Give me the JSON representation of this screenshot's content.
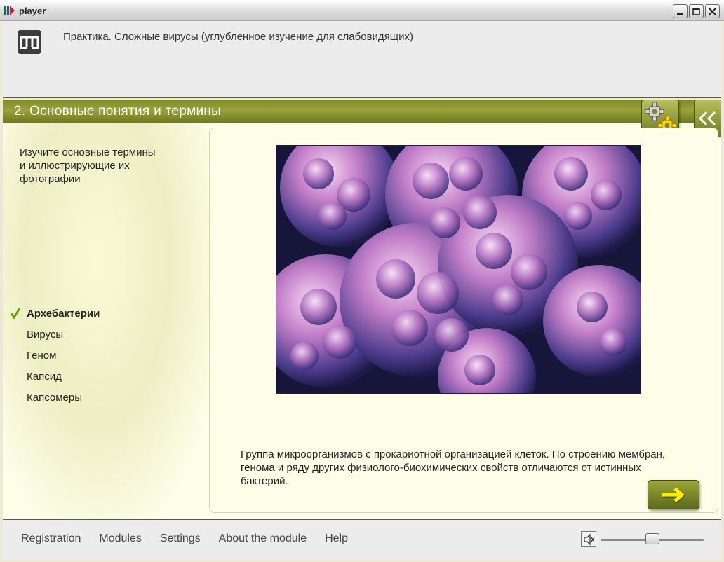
{
  "window": {
    "title": "player"
  },
  "header": {
    "module_title": "Практика. Сложные вирусы (углубленное изучение для слабовидящих)"
  },
  "section": {
    "title": "2. Основные понятия и термины"
  },
  "instructions": "Изучите основные термины и иллюстрирующие их фотографии",
  "terms": [
    {
      "label": "Архебактерии",
      "active": true
    },
    {
      "label": "Вирусы"
    },
    {
      "label": "Геном"
    },
    {
      "label": "Капсид"
    },
    {
      "label": "Капсомеры"
    }
  ],
  "description": "Группа микроорганизмов с прокариотной организацией клеток. По строению мембран, генома и ряду других физиолого-биохимических свойств отличаются от истинных бактерий.",
  "footer": {
    "menu": [
      "Registration",
      "Modules",
      "Settings",
      "About the module",
      "Help"
    ],
    "volume": 0.5
  },
  "colors": {
    "accent": "#8a9530",
    "accent_dark": "#5d6a1c",
    "arrow": "#ffee00",
    "check": "#6aa400"
  },
  "icons": [
    "app-icon",
    "minimize-icon",
    "maximize-icon",
    "close-icon",
    "module-logo-icon",
    "gear-icon",
    "collapse-arrows-icon",
    "check-icon",
    "next-arrow-icon",
    "speaker-icon"
  ]
}
